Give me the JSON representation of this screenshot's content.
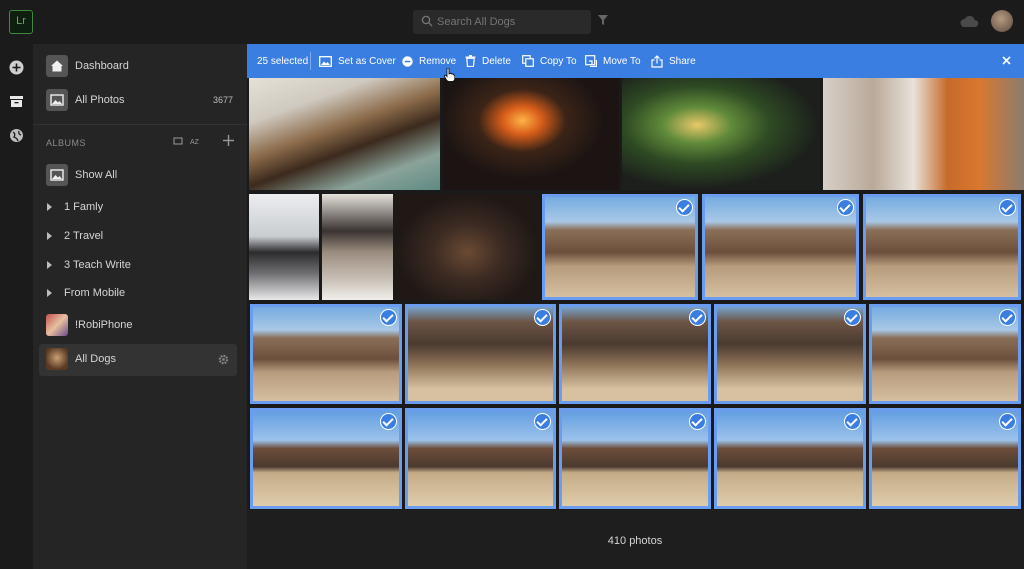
{
  "app": {
    "logo_text": "Lr"
  },
  "search": {
    "placeholder": "Search All Dogs"
  },
  "sidebar": {
    "dashboard": {
      "label": "Dashboard",
      "icon": "home-icon"
    },
    "all_photos": {
      "label": "All Photos",
      "count": "3677"
    },
    "albums_title": "ALBUMS",
    "items": [
      {
        "label": "Show All",
        "type": "album"
      },
      {
        "label": "1 Famly",
        "type": "folder"
      },
      {
        "label": "2 Travel",
        "type": "folder"
      },
      {
        "label": "3 Teach Write",
        "type": "folder"
      },
      {
        "label": "From Mobile",
        "type": "folder"
      },
      {
        "label": "!RobiPhone",
        "type": "album"
      },
      {
        "label": "All Dogs",
        "type": "album",
        "selected": true
      }
    ]
  },
  "actionbar": {
    "selected_text": "25 selected",
    "set_cover": "Set as Cover",
    "remove": "Remove",
    "delete": "Delete",
    "copy_to": "Copy To",
    "move_to": "Move To",
    "share": "Share",
    "color": "#3a7ee2"
  },
  "grid": {
    "rows": [
      [
        {
          "look": "dog-couch",
          "selected": false
        },
        {
          "look": "fire",
          "selected": false
        },
        {
          "look": "tree",
          "selected": false
        },
        {
          "look": "kitchen",
          "selected": false
        }
      ],
      [
        {
          "look": "snow",
          "selected": false
        },
        {
          "look": "dogs2",
          "selected": false
        },
        {
          "look": "dark",
          "selected": false
        },
        {
          "look": "west",
          "selected": true
        },
        {
          "look": "west",
          "selected": true
        },
        {
          "look": "west",
          "selected": true
        }
      ],
      [
        {
          "look": "west",
          "selected": true
        },
        {
          "look": "west-near",
          "selected": true
        },
        {
          "look": "west-near",
          "selected": true
        },
        {
          "look": "west-near",
          "selected": true
        },
        {
          "look": "west",
          "selected": true
        }
      ],
      [
        {
          "look": "horse",
          "selected": true
        },
        {
          "look": "horse",
          "selected": true
        },
        {
          "look": "horse",
          "selected": true
        },
        {
          "look": "horse",
          "selected": true
        },
        {
          "look": "horse",
          "selected": true
        }
      ]
    ]
  },
  "footer": {
    "count_text": "410 photos"
  }
}
